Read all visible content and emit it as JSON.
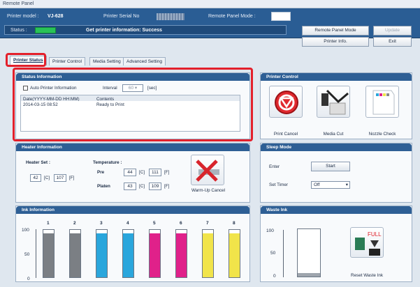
{
  "window": {
    "title": "Remote Panel"
  },
  "header": {
    "model_label": "Printer model :",
    "model_value": "VJ-628",
    "serial_label": "Printer Serial No",
    "mode_label": "Remote Panel Mode :",
    "status_label": "Status :",
    "status_value": "Get printer information: Success",
    "buttons": {
      "remote_panel_mode": "Remote Panel Mode",
      "update": "Update",
      "printer_info": "Printer Info.",
      "exit": "Exit"
    }
  },
  "tabs": [
    "Printer Status",
    "Printer Control",
    "Media Setting",
    "Advanced Setting"
  ],
  "status_info": {
    "title": "Status Information",
    "auto_label": "Auto Printer Information",
    "interval_label": "Interval",
    "interval_value": "60",
    "interval_unit": "[sec]",
    "col_date": "Date(YYYY-MM-DD HH:MM)",
    "col_contents": "Contents",
    "rows": [
      {
        "date": "2014-03-15 08:52",
        "contents": "Ready to Print"
      }
    ]
  },
  "printer_control": {
    "title": "Printer Control",
    "print_cancel": "Print Cancel",
    "media_cut": "Media Cut",
    "nozzle_check": "Nozzle Check"
  },
  "heater": {
    "title": "Heater Information",
    "set_label": "Heater Set :",
    "temp_label": "Temperature :",
    "set_c": "42",
    "set_f": "107",
    "pre_label": "Pre",
    "pre_c": "44",
    "pre_f": "111",
    "platen_label": "Platen",
    "platen_c": "43",
    "platen_f": "109",
    "unit_c": "[C]",
    "unit_f": "[F]",
    "warmup_cancel": "Warm-Up Cancel"
  },
  "sleep": {
    "title": "Sleep Mode",
    "enter_label": "Enter",
    "start_button": "Start",
    "timer_label": "Set Timer",
    "timer_value": "Off"
  },
  "ink": {
    "title": "Ink Information",
    "y_ticks": [
      "100",
      "50",
      "0"
    ],
    "slots": [
      "1",
      "2",
      "3",
      "4",
      "5",
      "6",
      "7",
      "8"
    ],
    "colors": [
      "#7b7f84",
      "#7b7f84",
      "#2aa6dc",
      "#2aa6dc",
      "#e0218a",
      "#e0218a",
      "#f1e44a",
      "#f1e44a"
    ],
    "levels": [
      0.93,
      0.93,
      0.93,
      0.93,
      0.93,
      0.93,
      0.93,
      0.93
    ]
  },
  "waste": {
    "title": "Waste Ink",
    "y_ticks": [
      "100",
      "50",
      "0"
    ],
    "level": 0.08,
    "reset_label": "Reset Waste Ink",
    "full_text": "FULL"
  }
}
